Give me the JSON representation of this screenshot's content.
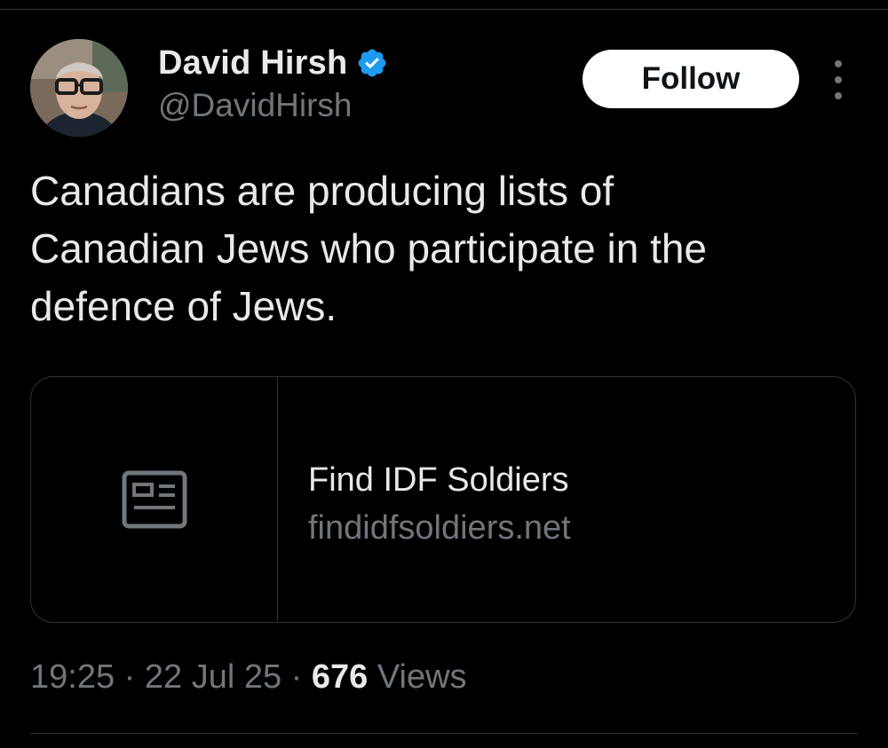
{
  "author": {
    "display_name": "David Hirsh",
    "handle": "@DavidHirsh",
    "verified": true,
    "verified_badge_color": "#1d9bf0"
  },
  "actions": {
    "follow_label": "Follow",
    "more_icon": "more-vertical-icon"
  },
  "tweet": {
    "text": "Canadians are producing lists of\nCanadian Jews who participate in the\ndefence of Jews."
  },
  "link_card": {
    "icon": "article-icon",
    "title": "Find IDF Soldiers",
    "domain": "findidfsoldiers.net"
  },
  "meta": {
    "time": "19:25",
    "separator": " · ",
    "date": "22 Jul 25",
    "views_count": "676",
    "views_label": " Views"
  },
  "colors": {
    "background": "#000000",
    "text_primary": "#e7e9ea",
    "text_secondary": "#71767b",
    "border": "#2f3336",
    "follow_bg": "#ffffff",
    "follow_text": "#0f1419"
  }
}
